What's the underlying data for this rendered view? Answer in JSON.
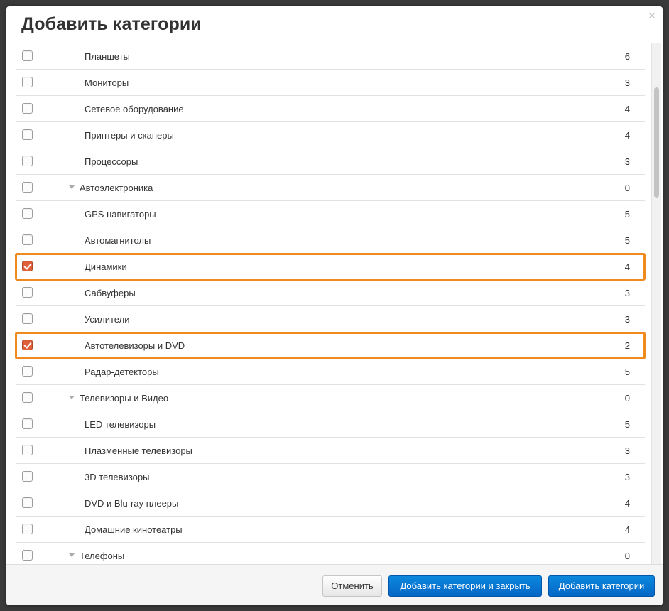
{
  "dialog": {
    "title": "Добавить категории",
    "close_glyph": "×"
  },
  "rows": [
    {
      "label": "Планшеты",
      "count": "6",
      "level": 2,
      "checked": false,
      "expandable": false
    },
    {
      "label": "Мониторы",
      "count": "3",
      "level": 2,
      "checked": false,
      "expandable": false
    },
    {
      "label": "Сетевое оборудование",
      "count": "4",
      "level": 2,
      "checked": false,
      "expandable": false
    },
    {
      "label": "Принтеры и сканеры",
      "count": "4",
      "level": 2,
      "checked": false,
      "expandable": false
    },
    {
      "label": "Процессоры",
      "count": "3",
      "level": 2,
      "checked": false,
      "expandable": false
    },
    {
      "label": "Автоэлектроника",
      "count": "0",
      "level": 1,
      "checked": false,
      "expandable": true
    },
    {
      "label": "GPS навигаторы",
      "count": "5",
      "level": 2,
      "checked": false,
      "expandable": false
    },
    {
      "label": "Автомагнитолы",
      "count": "5",
      "level": 2,
      "checked": false,
      "expandable": false
    },
    {
      "label": "Динамики",
      "count": "4",
      "level": 2,
      "checked": true,
      "expandable": false
    },
    {
      "label": "Сабвуферы",
      "count": "3",
      "level": 2,
      "checked": false,
      "expandable": false
    },
    {
      "label": "Усилители",
      "count": "3",
      "level": 2,
      "checked": false,
      "expandable": false
    },
    {
      "label": "Автотелевизоры и DVD",
      "count": "2",
      "level": 2,
      "checked": true,
      "expandable": false
    },
    {
      "label": "Радар-детекторы",
      "count": "5",
      "level": 2,
      "checked": false,
      "expandable": false
    },
    {
      "label": "Телевизоры и Видео",
      "count": "0",
      "level": 1,
      "checked": false,
      "expandable": true
    },
    {
      "label": "LED телевизоры",
      "count": "5",
      "level": 2,
      "checked": false,
      "expandable": false
    },
    {
      "label": "Плазменные телевизоры",
      "count": "3",
      "level": 2,
      "checked": false,
      "expandable": false
    },
    {
      "label": "3D телевизоры",
      "count": "3",
      "level": 2,
      "checked": false,
      "expandable": false
    },
    {
      "label": "DVD и Blu-ray плееры",
      "count": "4",
      "level": 2,
      "checked": false,
      "expandable": false
    },
    {
      "label": "Домашние кинотеатры",
      "count": "4",
      "level": 2,
      "checked": false,
      "expandable": false
    },
    {
      "label": "Телефоны",
      "count": "0",
      "level": 1,
      "checked": false,
      "expandable": true
    }
  ],
  "footer": {
    "cancel_label": "Отменить",
    "add_close_label": "Добавить категории и закрыть",
    "add_label": "Добавить категории"
  },
  "colors": {
    "primary_button": "#0566c6",
    "checked_checkbox": "#e0603a",
    "selection_outline": "#f08a1d"
  }
}
